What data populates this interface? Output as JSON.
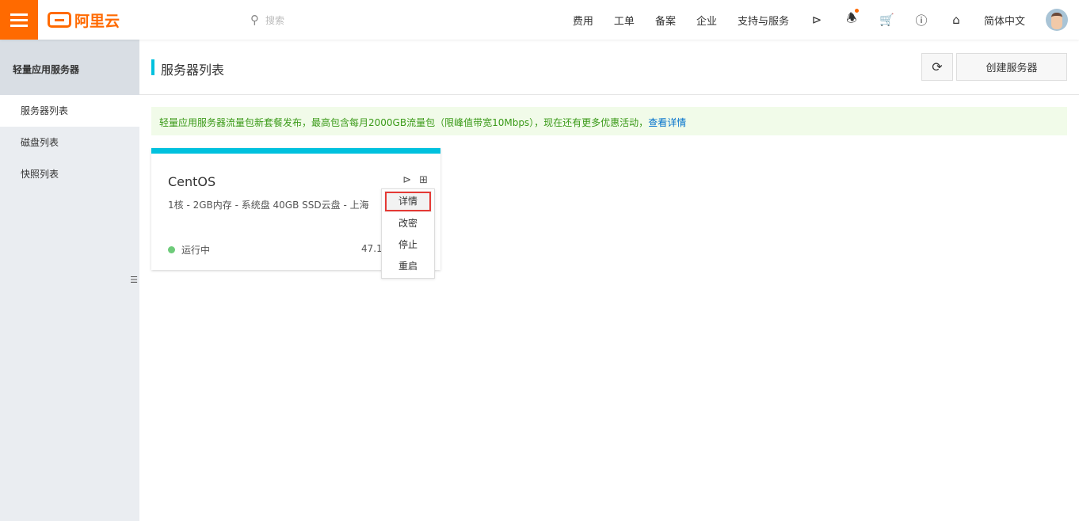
{
  "topbar": {
    "logo": "阿里云",
    "search_placeholder": "搜索",
    "nav": [
      "费用",
      "工单",
      "备案",
      "企业",
      "支持与服务"
    ],
    "icons": [
      "terminal-icon",
      "bell-icon",
      "cart-icon",
      "help-icon",
      "home-icon"
    ],
    "language": "简体中文",
    "accent": "#ff6a00"
  },
  "sidebar": {
    "title": "轻量应用服务器",
    "items": [
      {
        "label": "服务器列表",
        "active": true
      },
      {
        "label": "磁盘列表"
      },
      {
        "label": "快照列表"
      }
    ]
  },
  "page": {
    "title": "服务器列表",
    "create_button": "创建服务器",
    "refresh_icon": "refresh-icon"
  },
  "notice": {
    "text": "轻量应用服务器流量包新套餐发布，最高包含每月2000GB流量包（限峰值带宽10Mbps），现在还有更多优惠活动，",
    "link": "查看详情"
  },
  "card": {
    "name": "CentOS",
    "spec": "1核 - 2GB内存 - 系统盘 40GB SSD云盘 - 上海",
    "status": "运行中",
    "ip": "47.1",
    "status_color": "#6ecb7a"
  },
  "menu": {
    "items": [
      "详情",
      "改密",
      "停止",
      "重启"
    ],
    "selected": "详情"
  }
}
